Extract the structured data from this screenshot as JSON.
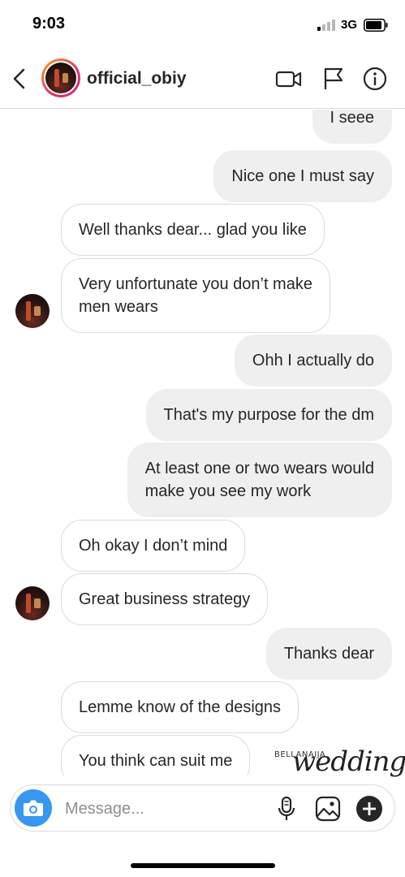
{
  "status_bar": {
    "time": "9:03",
    "network": "3G"
  },
  "header": {
    "username": "official_obiy",
    "icons": [
      "back-icon",
      "video-call-icon",
      "flag-icon",
      "info-icon"
    ]
  },
  "messages": [
    {
      "side": "sent",
      "lines": [
        "I seee"
      ]
    },
    {
      "side": "sent",
      "lines": [
        "Nice  one I must say"
      ]
    },
    {
      "side": "recv",
      "lines": [
        "Well thanks dear... glad you like"
      ]
    },
    {
      "side": "recv",
      "lines": [
        "Very unfortunate you don’t make",
        "men wears"
      ]
    },
    {
      "side": "sent",
      "lines": [
        "Ohh I actually do"
      ]
    },
    {
      "side": "sent",
      "lines": [
        "That's my purpose for the dm"
      ]
    },
    {
      "side": "sent",
      "lines": [
        "At least one or two wears would",
        "make you see my work"
      ]
    },
    {
      "side": "recv",
      "lines": [
        "Oh okay I don’t mind"
      ]
    },
    {
      "side": "recv",
      "lines": [
        "Great business strategy"
      ]
    },
    {
      "side": "sent",
      "lines": [
        "Thanks dear"
      ]
    },
    {
      "side": "recv",
      "lines": [
        "Lemme know of the designs"
      ]
    },
    {
      "side": "recv",
      "lines": [
        "You think can suit me"
      ]
    }
  ],
  "watermark": {
    "brand": "BELLANAIJA",
    "script": "weddings"
  },
  "composer": {
    "placeholder": "Message...",
    "icons": [
      "camera-icon",
      "microphone-icon",
      "gallery-icon",
      "add-icon"
    ]
  },
  "colors": {
    "accent": "#3897f0",
    "sent_bubble": "#efefef",
    "recv_border": "#dbdbdb"
  }
}
